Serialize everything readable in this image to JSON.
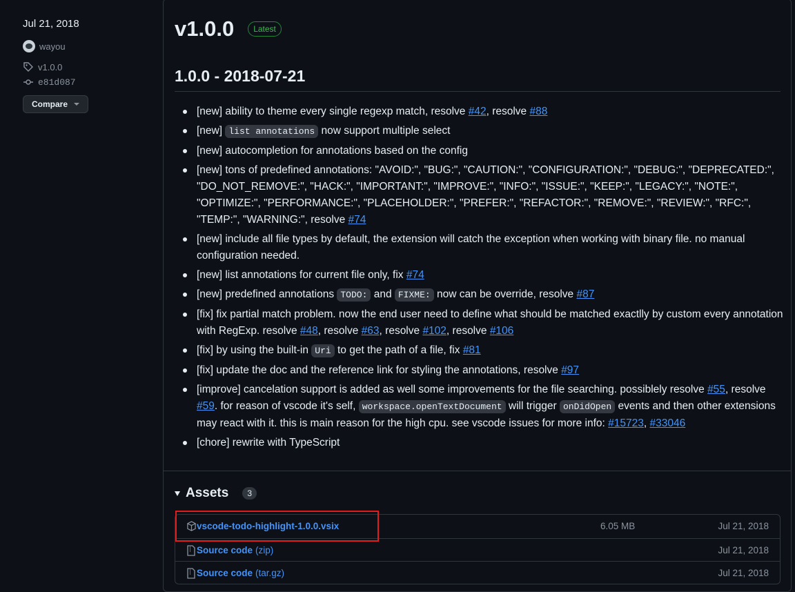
{
  "sidebar": {
    "date": "Jul 21, 2018",
    "author": "wayou",
    "tag": "v1.0.0",
    "commit": "e81d087",
    "compare_label": "Compare"
  },
  "release": {
    "version": "v1.0.0",
    "badge": "Latest",
    "heading": "1.0.0 - 2018-07-21"
  },
  "notes": [
    [
      "[new] ability to theme every single regexp match, resolve ",
      "#42",
      ", resolve ",
      "#88"
    ],
    [
      "[new] ",
      "list annotations",
      " now support multiple select"
    ],
    [
      "[new] autocompletion for annotations based on the config"
    ],
    [
      "[new] tons of predefined annotations: \"AVOID:\", \"BUG:\", \"CAUTION:\", \"CONFIGURATION:\", \"DEBUG:\", \"DEPRECATED:\", \"DO_NOT_REMOVE:\", \"HACK:\", \"IMPORTANT:\", \"IMPROVE:\", \"INFO:\", \"ISSUE:\", \"KEEP:\", \"LEGACY:\", \"NOTE:\", \"OPTIMIZE:\", \"PERFORMANCE:\", \"PLACEHOLDER:\", \"PREFER:\", \"REFACTOR:\", \"REMOVE:\", \"REVIEW:\", \"RFC:\", \"TEMP:\", \"WARNING:\", resolve ",
      "#74"
    ],
    [
      "[new] include all file types by default, the extension will catch the exception when working with binary file. no manual configuration needed."
    ],
    [
      "[new] list annotations for current file only, fix ",
      "#74"
    ],
    [
      "[new] predefined annotations ",
      "TODO:",
      " and ",
      "FIXME:",
      " now can be override, resolve ",
      "#87"
    ],
    [
      "[fix] fix partial match problem. now the end user need to define what should be matched exactlly by custom every annotation with RegExp. resolve ",
      "#48",
      ", resolve ",
      "#63",
      ", resolve ",
      "#102",
      ", resolve ",
      "#106"
    ],
    [
      "[fix] by using the built-in ",
      "Uri",
      " to get the path of a file, fix ",
      "#81"
    ],
    [
      "[fix] update the doc and the reference link for styling the annotations, resolve ",
      "#97"
    ],
    [
      "[improve] cancelation support is added as well some improvements for the file searching. possiblely resolve ",
      "#55",
      ", resolve ",
      "#59",
      ". for reason of vscode it's self, ",
      "workspace.openTextDocument",
      " will trigger ",
      "onDidOpen",
      " events and then other extensions may react with it. this is main reason for the high cpu. see vscode issues for more info: ",
      "#15723",
      ", ",
      "#33046"
    ],
    [
      "[chore] rewrite with TypeScript"
    ]
  ],
  "assets": {
    "title": "Assets",
    "count": "3",
    "items": [
      {
        "name": "vscode-todo-highlight-1.0.0.vsix",
        "ext": "",
        "size": "6.05 MB",
        "date": "Jul 21, 2018",
        "icon": "package-icon"
      },
      {
        "name": "Source code",
        "ext": "(zip)",
        "size": "",
        "date": "Jul 21, 2018",
        "icon": "file-zip-icon"
      },
      {
        "name": "Source code",
        "ext": "(tar.gz)",
        "size": "",
        "date": "Jul 21, 2018",
        "icon": "file-zip-icon"
      }
    ]
  },
  "colors": {
    "background": "#0d1117",
    "link": "#4493f8",
    "badge": "#3fb950",
    "highlight": "#e01e1e"
  }
}
